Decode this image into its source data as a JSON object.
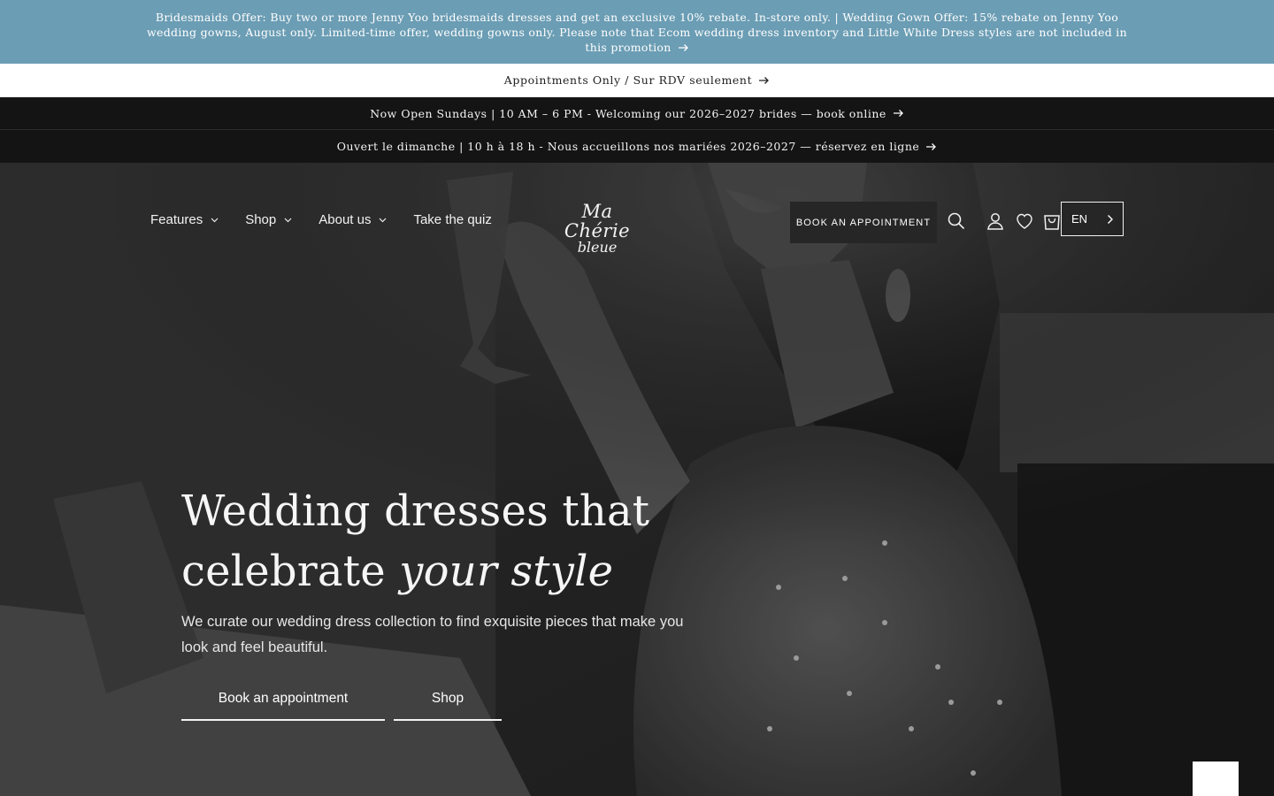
{
  "announcements": {
    "promo": "Bridesmaids Offer: Buy two or more Jenny Yoo bridesmaids dresses and get an exclusive 10% rebate. In-store only. | Wedding Gown Offer: 15% rebate on Jenny Yoo wedding gowns, August only. Limited-time offer, wedding gowns only. Please note that Ecom wedding dress inventory and Little White Dress styles are not included in this promotion",
    "appointments": "Appointments Only / Sur RDV seulement",
    "hours_en": "Now Open Sundays | 10 AM – 6 PM - Welcoming our 2026–2027 brides — book online",
    "hours_fr": "Ouvert le dimanche | 10 h à 18 h - Nous accueillons nos mariées 2026–2027 — réservez en ligne"
  },
  "header": {
    "nav": [
      {
        "label": "Features",
        "has_dropdown": true
      },
      {
        "label": "Shop",
        "has_dropdown": true
      },
      {
        "label": "About us",
        "has_dropdown": true
      },
      {
        "label": "Take the quiz",
        "has_dropdown": false
      }
    ],
    "logo_line1": "Ma Chérie",
    "logo_line2": "bleue",
    "appointment_button": "BOOK AN APPOINTMENT",
    "icons": [
      "search-icon",
      "account-icon",
      "wishlist-heart-icon",
      "cart-icon"
    ],
    "language": "EN"
  },
  "hero": {
    "title_line1": "Wedding dresses that",
    "title_line2_plain": "celebrate ",
    "title_line2_italic": "your style",
    "subtitle": "We curate our wedding dress collection to find exquisite pieces that make you look and feel beautiful.",
    "button_primary": "Book an appointment",
    "button_secondary": "Shop"
  },
  "colors": {
    "promo_bar": "#6b9db4",
    "dark_bar": "#141414",
    "appointment_button_bg": "#262626"
  }
}
